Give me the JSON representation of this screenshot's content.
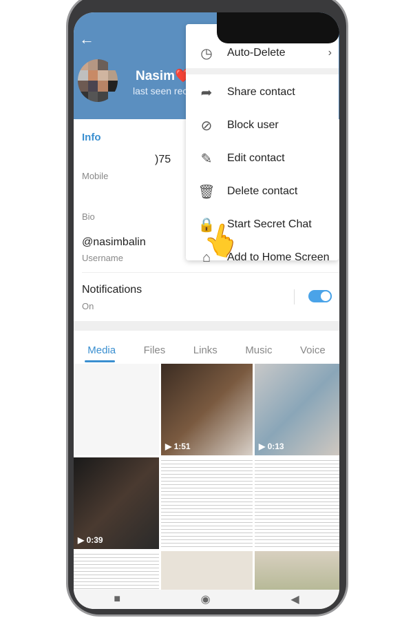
{
  "header": {
    "name": "Nasim❤️",
    "status": "last seen rec"
  },
  "info": {
    "section": "Info",
    "phone_fragment": ")75",
    "phone_label": "Mobile",
    "bio_label": "Bio",
    "username": "@nasimbalin",
    "username_label": "Username",
    "notifications_label": "Notifications",
    "notifications_value": "On",
    "notifications_enabled": true
  },
  "menu": {
    "items": [
      {
        "label": "Auto-Delete",
        "icon": "timer-icon"
      },
      {
        "label": "Share contact",
        "icon": "share-icon"
      },
      {
        "label": "Block user",
        "icon": "block-icon"
      },
      {
        "label": "Edit contact",
        "icon": "pencil-icon"
      },
      {
        "label": "Delete contact",
        "icon": "trash-icon"
      },
      {
        "label": "Start Secret Chat",
        "icon": "lock-icon"
      },
      {
        "label": "Add to Home Screen",
        "icon": "home-add-icon"
      }
    ]
  },
  "tabs": [
    "Media",
    "Files",
    "Links",
    "Music",
    "Voice"
  ],
  "active_tab": "Media",
  "media": [
    {
      "duration": ""
    },
    {
      "duration": "1:51"
    },
    {
      "duration": "0:13"
    },
    {
      "duration": "0:39"
    },
    {
      "duration": ""
    },
    {
      "duration": ""
    },
    {
      "duration": ""
    },
    {
      "duration": ""
    },
    {
      "duration": ""
    }
  ],
  "colors": {
    "header": "#5b8fc0",
    "accent": "#3a8fd0",
    "toggle": "#4aa3e8"
  }
}
